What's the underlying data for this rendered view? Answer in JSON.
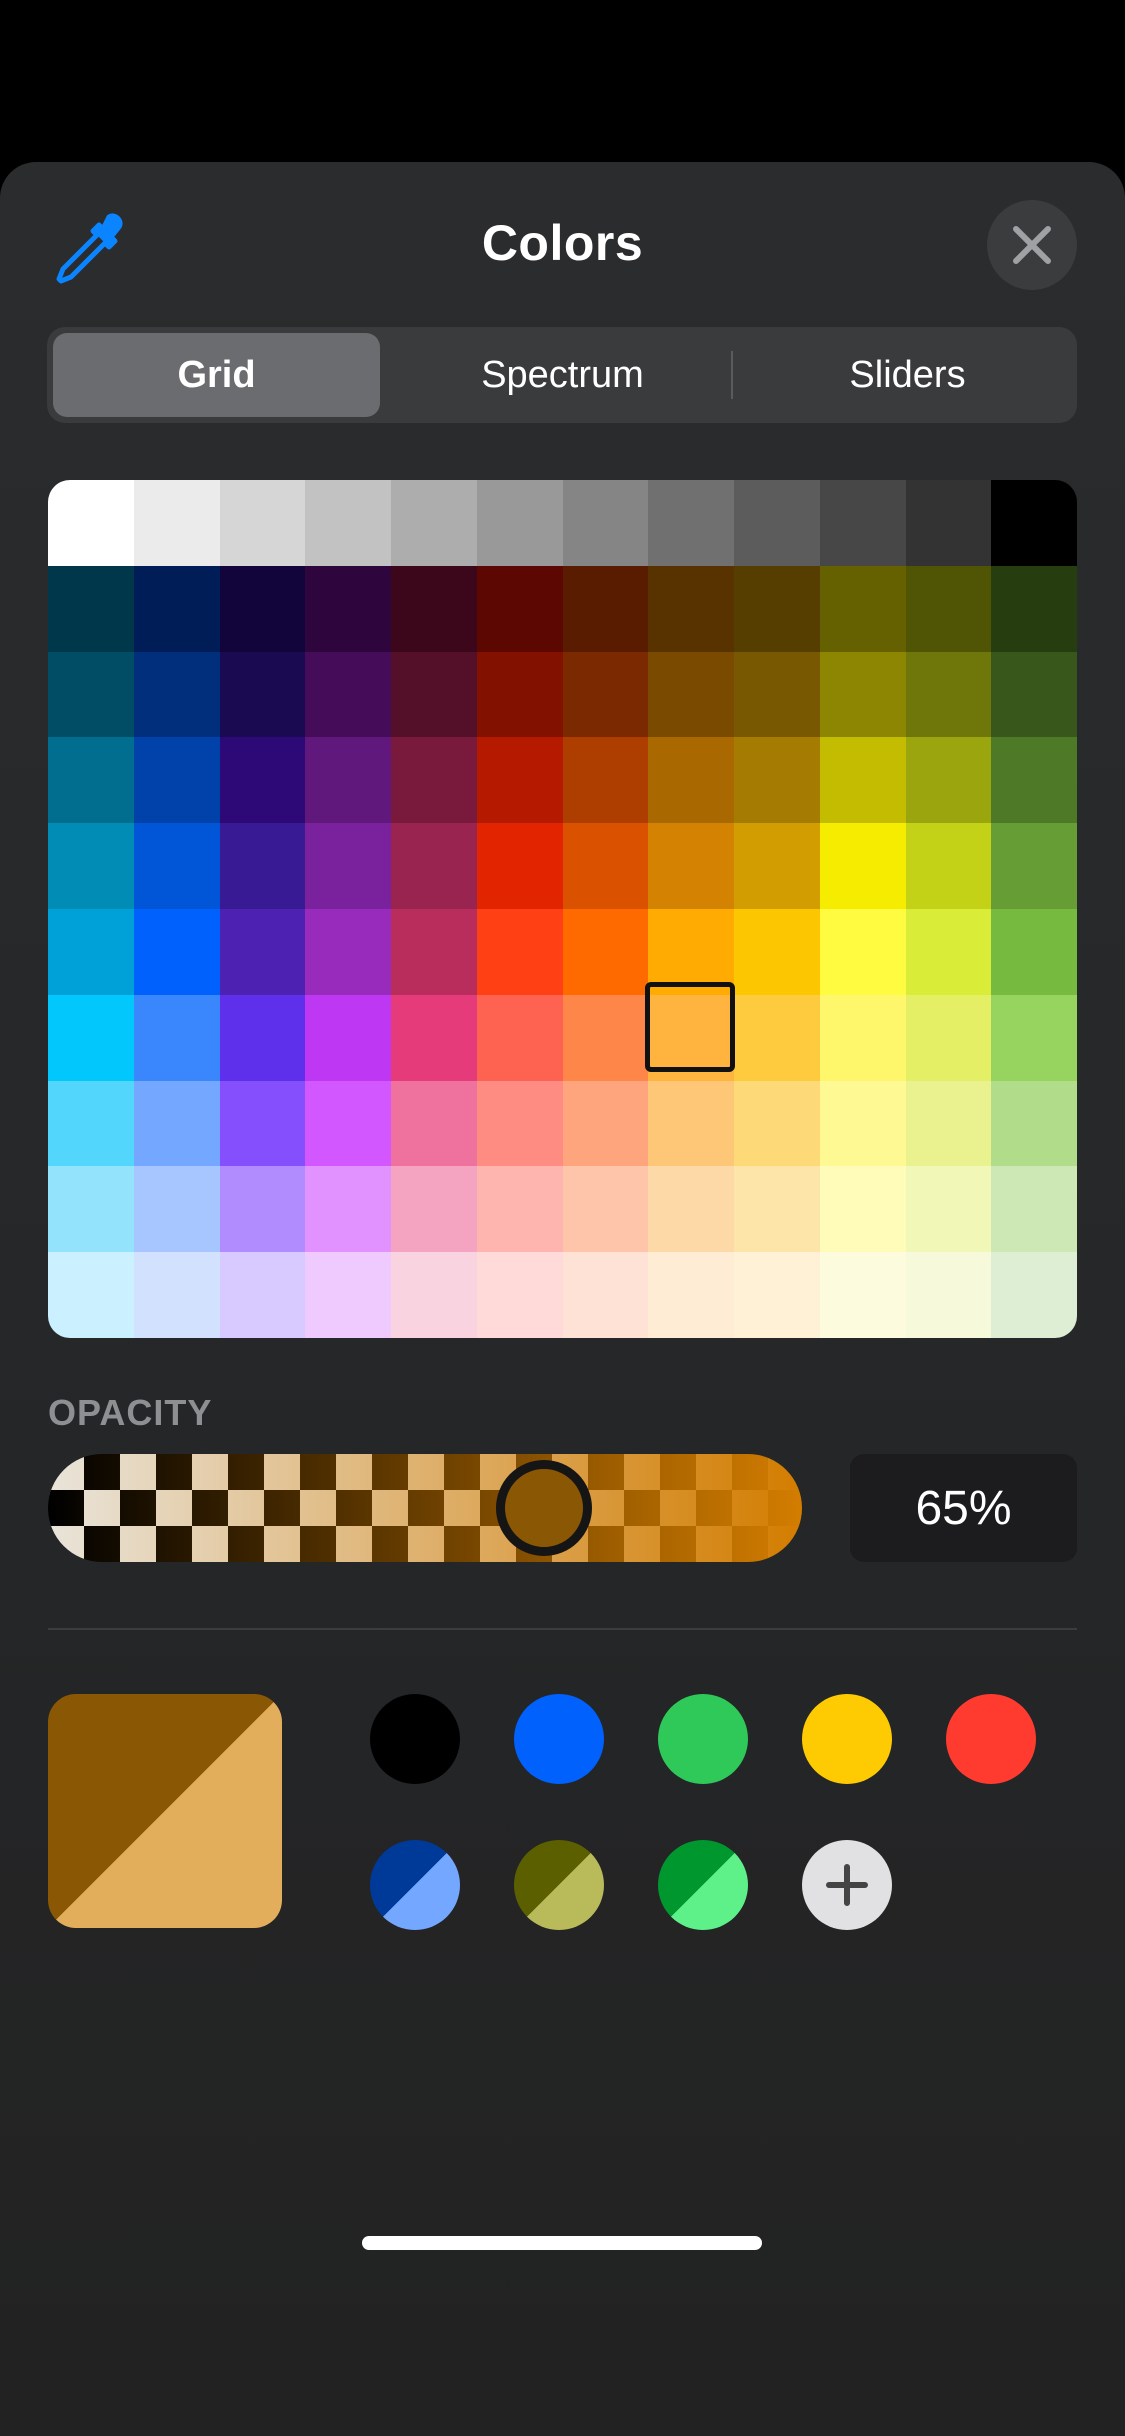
{
  "header": {
    "title": "Colors",
    "eyedropper_icon": "eyedropper-icon",
    "close_icon": "close-icon"
  },
  "tabs": [
    {
      "label": "Grid",
      "selected": true
    },
    {
      "label": "Spectrum",
      "selected": false
    },
    {
      "label": "Sliders",
      "selected": false
    }
  ],
  "grid": {
    "columns": 12,
    "rows": 10,
    "selected_row": 4,
    "selected_col": 7,
    "colors": [
      [
        "#ffffff",
        "#ebebeb",
        "#d6d6d6",
        "#c2c2c2",
        "#adadad",
        "#999999",
        "#858585",
        "#707070",
        "#5c5c5c",
        "#474747",
        "#333333",
        "#000000"
      ],
      [
        "#00374a",
        "#011d57",
        "#11053b",
        "#2e063d",
        "#3c071b",
        "#5c0701",
        "#5a1c00",
        "#583300",
        "#563d00",
        "#666100",
        "#4f5504",
        "#263e0f"
      ],
      [
        "#004d65",
        "#012f7b",
        "#1a0a52",
        "#450d59",
        "#551029",
        "#831100",
        "#7b2900",
        "#7a4a00",
        "#785800",
        "#8c8602",
        "#6f760a",
        "#38571a"
      ],
      [
        "#016e8f",
        "#0042a9",
        "#2c0977",
        "#61187c",
        "#791a3d",
        "#b51a00",
        "#ad3e00",
        "#a96800",
        "#a67b01",
        "#c4bc00",
        "#9ba50e",
        "#4e7a27"
      ],
      [
        "#008cb4",
        "#0056d6",
        "#371a94",
        "#7a219e",
        "#99244f",
        "#e22400",
        "#da5100",
        "#d38301",
        "#d19d01",
        "#f5ec00",
        "#c3d117",
        "#669d34"
      ],
      [
        "#00a1d8",
        "#0061fd",
        "#4d22b2",
        "#982abc",
        "#b92d5d",
        "#ff4015",
        "#ff6a00",
        "#ffab01",
        "#fcc700",
        "#fefb41",
        "#d9ec37",
        "#76bb40"
      ],
      [
        "#01c7fc",
        "#3a87fd",
        "#5e30eb",
        "#be38f3",
        "#e63b7a",
        "#fe6250",
        "#fe8648",
        "#feb43f",
        "#fecb3e",
        "#fff76b",
        "#e4ef65",
        "#96d35f"
      ],
      [
        "#52d6fc",
        "#74a7ff",
        "#864ffd",
        "#d357fe",
        "#ee719e",
        "#ff8c82",
        "#fea57d",
        "#fec777",
        "#fed977",
        "#fff994",
        "#eaf28f",
        "#b1dd8b"
      ],
      [
        "#93e3fc",
        "#a7c6ff",
        "#b18cfe",
        "#e292fe",
        "#f4a4c0",
        "#ffb5af",
        "#ffc5ab",
        "#fed9a8",
        "#fde4a8",
        "#fffbb9",
        "#f1f7b7",
        "#cde8b5"
      ],
      [
        "#cbf0ff",
        "#d2e2fe",
        "#d8c9fe",
        "#efcaff",
        "#f9d3e0",
        "#ffdad8",
        "#ffe2d6",
        "#feecd4",
        "#fef1d5",
        "#fdfbdd",
        "#f6fadb",
        "#deeed4"
      ]
    ]
  },
  "opacity": {
    "label": "OPACITY",
    "value": 0.65,
    "value_text": "65%",
    "color": "#d37d00"
  },
  "current_color": {
    "solid": "#8a5705",
    "with_opacity": "#e2ae5c"
  },
  "favorites": [
    {
      "name": "black",
      "a": "#000000",
      "b": "#000000"
    },
    {
      "name": "blue",
      "a": "#0061fd",
      "b": "#0061fd"
    },
    {
      "name": "green",
      "a": "#2fc95a",
      "b": "#2fc95a"
    },
    {
      "name": "yellow",
      "a": "#fecb02",
      "b": "#fecb02"
    },
    {
      "name": "red",
      "a": "#ff3b30",
      "b": "#ff3b30"
    },
    {
      "name": "navy-light-blue",
      "a": "#003a99",
      "b": "#74a7ff"
    },
    {
      "name": "olive-light-olive",
      "a": "#5b5f00",
      "b": "#b9bb5b"
    },
    {
      "name": "green-light-green",
      "a": "#00982e",
      "b": "#5ef18a"
    }
  ],
  "add_button_icon": "plus-icon"
}
